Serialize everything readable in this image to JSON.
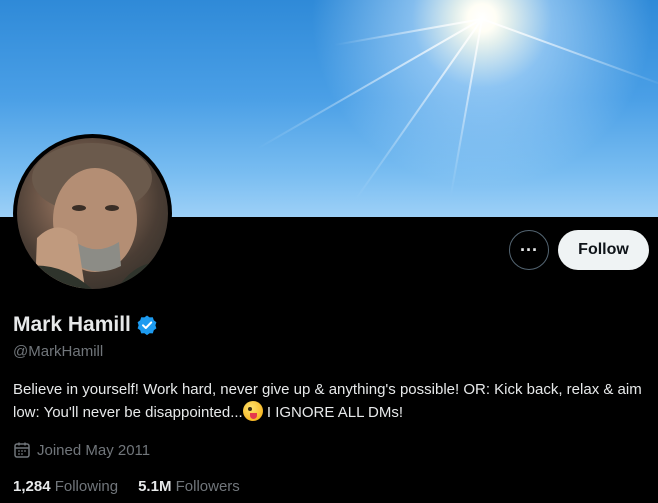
{
  "profile": {
    "name": "Mark Hamill",
    "handle": "@MarkHamill",
    "bio_main": "Believe in yourself! Work hard, never give up & anything's possible! OR: Kick back, relax & aim low: You'll never be disappointed...",
    "bio_emoji": "winking-face-with-tongue",
    "bio_tail": " I IGNORE ALL DMs!",
    "joined": "Joined May 2011",
    "following_count": "1,284",
    "following_label": "Following",
    "followers_count": "5.1M",
    "followers_label": "Followers"
  },
  "actions": {
    "more_label": "···",
    "follow_label": "Follow"
  },
  "colors": {
    "background": "#000000",
    "verified": "#1d9bf0",
    "secondary_text": "#71767b",
    "follow_button_bg": "#eff3f4"
  }
}
